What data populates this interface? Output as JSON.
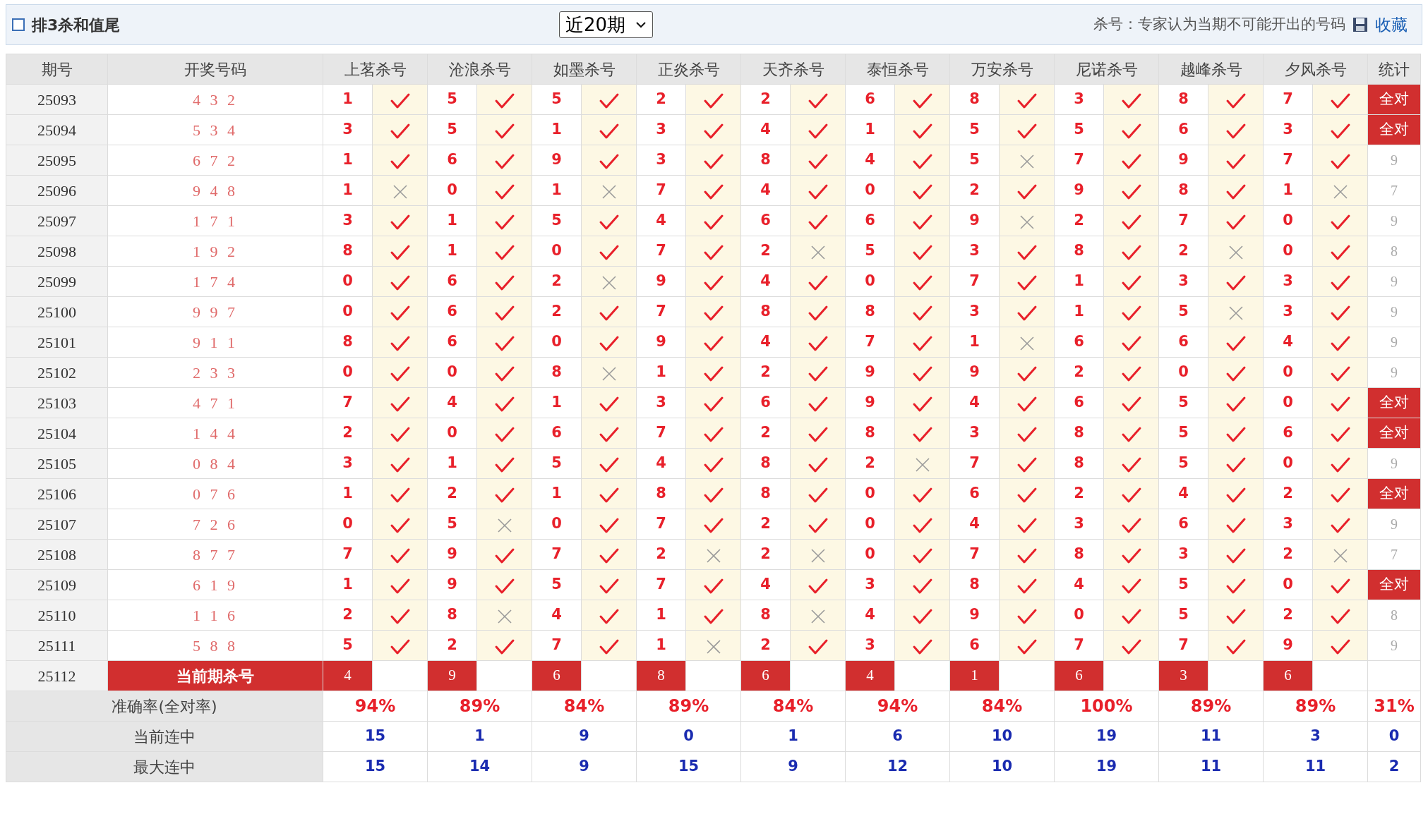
{
  "header": {
    "title": "排3杀和值尾",
    "period_select": "近20期",
    "note": "杀号：专家认为当期不可能开出的号码",
    "favorite": "收藏"
  },
  "table": {
    "columns": [
      "期号",
      "开奖号码",
      "上茗杀号",
      "沧浪杀号",
      "如墨杀号",
      "正炎杀号",
      "天齐杀号",
      "泰恒杀号",
      "万安杀号",
      "尼诺杀号",
      "越峰杀号",
      "夕风杀号",
      "统计"
    ],
    "rows": [
      {
        "period": "25093",
        "draw": "4 3 2",
        "kills": [
          {
            "number": "1",
            "correct": true
          },
          {
            "number": "5",
            "correct": true
          },
          {
            "number": "5",
            "correct": true
          },
          {
            "number": "2",
            "correct": true
          },
          {
            "number": "2",
            "correct": true
          },
          {
            "number": "6",
            "correct": true
          },
          {
            "number": "8",
            "correct": true
          },
          {
            "number": "3",
            "correct": true
          },
          {
            "number": "8",
            "correct": true
          },
          {
            "number": "7",
            "correct": true
          }
        ],
        "stat": {
          "kind": "all_correct",
          "text": "全对"
        }
      },
      {
        "period": "25094",
        "draw": "5 3 4",
        "kills": [
          {
            "number": "3",
            "correct": true
          },
          {
            "number": "5",
            "correct": true
          },
          {
            "number": "1",
            "correct": true
          },
          {
            "number": "3",
            "correct": true
          },
          {
            "number": "4",
            "correct": true
          },
          {
            "number": "1",
            "correct": true
          },
          {
            "number": "5",
            "correct": true
          },
          {
            "number": "5",
            "correct": true
          },
          {
            "number": "6",
            "correct": true
          },
          {
            "number": "3",
            "correct": true
          }
        ],
        "stat": {
          "kind": "all_correct",
          "text": "全对"
        }
      },
      {
        "period": "25095",
        "draw": "6 7 2",
        "kills": [
          {
            "number": "1",
            "correct": true
          },
          {
            "number": "6",
            "correct": true
          },
          {
            "number": "9",
            "correct": true
          },
          {
            "number": "3",
            "correct": true
          },
          {
            "number": "8",
            "correct": true
          },
          {
            "number": "4",
            "correct": true
          },
          {
            "number": "5",
            "correct": false
          },
          {
            "number": "7",
            "correct": true
          },
          {
            "number": "9",
            "correct": true
          },
          {
            "number": "7",
            "correct": true
          }
        ],
        "stat": {
          "kind": "count",
          "text": "9"
        }
      },
      {
        "period": "25096",
        "draw": "9 4 8",
        "kills": [
          {
            "number": "1",
            "correct": false
          },
          {
            "number": "0",
            "correct": true
          },
          {
            "number": "1",
            "correct": false
          },
          {
            "number": "7",
            "correct": true
          },
          {
            "number": "4",
            "correct": true
          },
          {
            "number": "0",
            "correct": true
          },
          {
            "number": "2",
            "correct": true
          },
          {
            "number": "9",
            "correct": true
          },
          {
            "number": "8",
            "correct": true
          },
          {
            "number": "1",
            "correct": false
          }
        ],
        "stat": {
          "kind": "count",
          "text": "7"
        }
      },
      {
        "period": "25097",
        "draw": "1 7 1",
        "kills": [
          {
            "number": "3",
            "correct": true
          },
          {
            "number": "1",
            "correct": true
          },
          {
            "number": "5",
            "correct": true
          },
          {
            "number": "4",
            "correct": true
          },
          {
            "number": "6",
            "correct": true
          },
          {
            "number": "6",
            "correct": true
          },
          {
            "number": "9",
            "correct": false
          },
          {
            "number": "2",
            "correct": true
          },
          {
            "number": "7",
            "correct": true
          },
          {
            "number": "0",
            "correct": true
          }
        ],
        "stat": {
          "kind": "count",
          "text": "9"
        }
      },
      {
        "period": "25098",
        "draw": "1 9 2",
        "kills": [
          {
            "number": "8",
            "correct": true
          },
          {
            "number": "1",
            "correct": true
          },
          {
            "number": "0",
            "correct": true
          },
          {
            "number": "7",
            "correct": true
          },
          {
            "number": "2",
            "correct": false
          },
          {
            "number": "5",
            "correct": true
          },
          {
            "number": "3",
            "correct": true
          },
          {
            "number": "8",
            "correct": true
          },
          {
            "number": "2",
            "correct": false
          },
          {
            "number": "0",
            "correct": true
          }
        ],
        "stat": {
          "kind": "count",
          "text": "8"
        }
      },
      {
        "period": "25099",
        "draw": "1 7 4",
        "kills": [
          {
            "number": "0",
            "correct": true
          },
          {
            "number": "6",
            "correct": true
          },
          {
            "number": "2",
            "correct": false
          },
          {
            "number": "9",
            "correct": true
          },
          {
            "number": "4",
            "correct": true
          },
          {
            "number": "0",
            "correct": true
          },
          {
            "number": "7",
            "correct": true
          },
          {
            "number": "1",
            "correct": true
          },
          {
            "number": "3",
            "correct": true
          },
          {
            "number": "3",
            "correct": true
          }
        ],
        "stat": {
          "kind": "count",
          "text": "9"
        }
      },
      {
        "period": "25100",
        "draw": "9 9 7",
        "kills": [
          {
            "number": "0",
            "correct": true
          },
          {
            "number": "6",
            "correct": true
          },
          {
            "number": "2",
            "correct": true
          },
          {
            "number": "7",
            "correct": true
          },
          {
            "number": "8",
            "correct": true
          },
          {
            "number": "8",
            "correct": true
          },
          {
            "number": "3",
            "correct": true
          },
          {
            "number": "1",
            "correct": true
          },
          {
            "number": "5",
            "correct": false
          },
          {
            "number": "3",
            "correct": true
          }
        ],
        "stat": {
          "kind": "count",
          "text": "9"
        }
      },
      {
        "period": "25101",
        "draw": "9 1 1",
        "kills": [
          {
            "number": "8",
            "correct": true
          },
          {
            "number": "6",
            "correct": true
          },
          {
            "number": "0",
            "correct": true
          },
          {
            "number": "9",
            "correct": true
          },
          {
            "number": "4",
            "correct": true
          },
          {
            "number": "7",
            "correct": true
          },
          {
            "number": "1",
            "correct": false
          },
          {
            "number": "6",
            "correct": true
          },
          {
            "number": "6",
            "correct": true
          },
          {
            "number": "4",
            "correct": true
          }
        ],
        "stat": {
          "kind": "count",
          "text": "9"
        }
      },
      {
        "period": "25102",
        "draw": "2 3 3",
        "kills": [
          {
            "number": "0",
            "correct": true
          },
          {
            "number": "0",
            "correct": true
          },
          {
            "number": "8",
            "correct": false
          },
          {
            "number": "1",
            "correct": true
          },
          {
            "number": "2",
            "correct": true
          },
          {
            "number": "9",
            "correct": true
          },
          {
            "number": "9",
            "correct": true
          },
          {
            "number": "2",
            "correct": true
          },
          {
            "number": "0",
            "correct": true
          },
          {
            "number": "0",
            "correct": true
          }
        ],
        "stat": {
          "kind": "count",
          "text": "9"
        }
      },
      {
        "period": "25103",
        "draw": "4 7 1",
        "kills": [
          {
            "number": "7",
            "correct": true
          },
          {
            "number": "4",
            "correct": true
          },
          {
            "number": "1",
            "correct": true
          },
          {
            "number": "3",
            "correct": true
          },
          {
            "number": "6",
            "correct": true
          },
          {
            "number": "9",
            "correct": true
          },
          {
            "number": "4",
            "correct": true
          },
          {
            "number": "6",
            "correct": true
          },
          {
            "number": "5",
            "correct": true
          },
          {
            "number": "0",
            "correct": true
          }
        ],
        "stat": {
          "kind": "all_correct",
          "text": "全对"
        }
      },
      {
        "period": "25104",
        "draw": "1 4 4",
        "kills": [
          {
            "number": "2",
            "correct": true
          },
          {
            "number": "0",
            "correct": true
          },
          {
            "number": "6",
            "correct": true
          },
          {
            "number": "7",
            "correct": true
          },
          {
            "number": "2",
            "correct": true
          },
          {
            "number": "8",
            "correct": true
          },
          {
            "number": "3",
            "correct": true
          },
          {
            "number": "8",
            "correct": true
          },
          {
            "number": "5",
            "correct": true
          },
          {
            "number": "6",
            "correct": true
          }
        ],
        "stat": {
          "kind": "all_correct",
          "text": "全对"
        }
      },
      {
        "period": "25105",
        "draw": "0 8 4",
        "kills": [
          {
            "number": "3",
            "correct": true
          },
          {
            "number": "1",
            "correct": true
          },
          {
            "number": "5",
            "correct": true
          },
          {
            "number": "4",
            "correct": true
          },
          {
            "number": "8",
            "correct": true
          },
          {
            "number": "2",
            "correct": false
          },
          {
            "number": "7",
            "correct": true
          },
          {
            "number": "8",
            "correct": true
          },
          {
            "number": "5",
            "correct": true
          },
          {
            "number": "0",
            "correct": true
          }
        ],
        "stat": {
          "kind": "count",
          "text": "9"
        }
      },
      {
        "period": "25106",
        "draw": "0 7 6",
        "kills": [
          {
            "number": "1",
            "correct": true
          },
          {
            "number": "2",
            "correct": true
          },
          {
            "number": "1",
            "correct": true
          },
          {
            "number": "8",
            "correct": true
          },
          {
            "number": "8",
            "correct": true
          },
          {
            "number": "0",
            "correct": true
          },
          {
            "number": "6",
            "correct": true
          },
          {
            "number": "2",
            "correct": true
          },
          {
            "number": "4",
            "correct": true
          },
          {
            "number": "2",
            "correct": true
          }
        ],
        "stat": {
          "kind": "all_correct",
          "text": "全对"
        }
      },
      {
        "period": "25107",
        "draw": "7 2 6",
        "kills": [
          {
            "number": "0",
            "correct": true
          },
          {
            "number": "5",
            "correct": false
          },
          {
            "number": "0",
            "correct": true
          },
          {
            "number": "7",
            "correct": true
          },
          {
            "number": "2",
            "correct": true
          },
          {
            "number": "0",
            "correct": true
          },
          {
            "number": "4",
            "correct": true
          },
          {
            "number": "3",
            "correct": true
          },
          {
            "number": "6",
            "correct": true
          },
          {
            "number": "3",
            "correct": true
          }
        ],
        "stat": {
          "kind": "count",
          "text": "9"
        }
      },
      {
        "period": "25108",
        "draw": "8 7 7",
        "kills": [
          {
            "number": "7",
            "correct": true
          },
          {
            "number": "9",
            "correct": true
          },
          {
            "number": "7",
            "correct": true
          },
          {
            "number": "2",
            "correct": false
          },
          {
            "number": "2",
            "correct": false
          },
          {
            "number": "0",
            "correct": true
          },
          {
            "number": "7",
            "correct": true
          },
          {
            "number": "8",
            "correct": true
          },
          {
            "number": "3",
            "correct": true
          },
          {
            "number": "2",
            "correct": false
          }
        ],
        "stat": {
          "kind": "count",
          "text": "7"
        }
      },
      {
        "period": "25109",
        "draw": "6 1 9",
        "kills": [
          {
            "number": "1",
            "correct": true
          },
          {
            "number": "9",
            "correct": true
          },
          {
            "number": "5",
            "correct": true
          },
          {
            "number": "7",
            "correct": true
          },
          {
            "number": "4",
            "correct": true
          },
          {
            "number": "3",
            "correct": true
          },
          {
            "number": "8",
            "correct": true
          },
          {
            "number": "4",
            "correct": true
          },
          {
            "number": "5",
            "correct": true
          },
          {
            "number": "0",
            "correct": true
          }
        ],
        "stat": {
          "kind": "all_correct",
          "text": "全对"
        }
      },
      {
        "period": "25110",
        "draw": "1 1 6",
        "kills": [
          {
            "number": "2",
            "correct": true
          },
          {
            "number": "8",
            "correct": false
          },
          {
            "number": "4",
            "correct": true
          },
          {
            "number": "1",
            "correct": true
          },
          {
            "number": "8",
            "correct": false
          },
          {
            "number": "4",
            "correct": true
          },
          {
            "number": "9",
            "correct": true
          },
          {
            "number": "0",
            "correct": true
          },
          {
            "number": "5",
            "correct": true
          },
          {
            "number": "2",
            "correct": true
          }
        ],
        "stat": {
          "kind": "count",
          "text": "8"
        }
      },
      {
        "period": "25111",
        "draw": "5 8 8",
        "kills": [
          {
            "number": "5",
            "correct": true
          },
          {
            "number": "2",
            "correct": true
          },
          {
            "number": "7",
            "correct": true
          },
          {
            "number": "1",
            "correct": false
          },
          {
            "number": "2",
            "correct": true
          },
          {
            "number": "3",
            "correct": true
          },
          {
            "number": "6",
            "correct": true
          },
          {
            "number": "7",
            "correct": true
          },
          {
            "number": "7",
            "correct": true
          },
          {
            "number": "9",
            "correct": true
          }
        ],
        "stat": {
          "kind": "count",
          "text": "9"
        }
      }
    ],
    "current": {
      "period": "25112",
      "label": "当前期杀号",
      "kills": [
        "4",
        "9",
        "6",
        "8",
        "6",
        "4",
        "1",
        "6",
        "3",
        "6"
      ]
    },
    "summary": [
      {
        "kind": "rate",
        "label": "准确率(全对率)",
        "values": [
          "94%",
          "89%",
          "84%",
          "89%",
          "84%",
          "94%",
          "84%",
          "100%",
          "89%",
          "89%"
        ],
        "stat": "31%"
      },
      {
        "kind": "streak",
        "label": "当前连中",
        "values": [
          "15",
          "1",
          "9",
          "0",
          "1",
          "6",
          "10",
          "19",
          "11",
          "3"
        ],
        "stat": "0"
      },
      {
        "kind": "streak",
        "label": "最大连中",
        "values": [
          "15",
          "14",
          "9",
          "15",
          "9",
          "12",
          "10",
          "19",
          "11",
          "11"
        ],
        "stat": "2"
      }
    ]
  }
}
